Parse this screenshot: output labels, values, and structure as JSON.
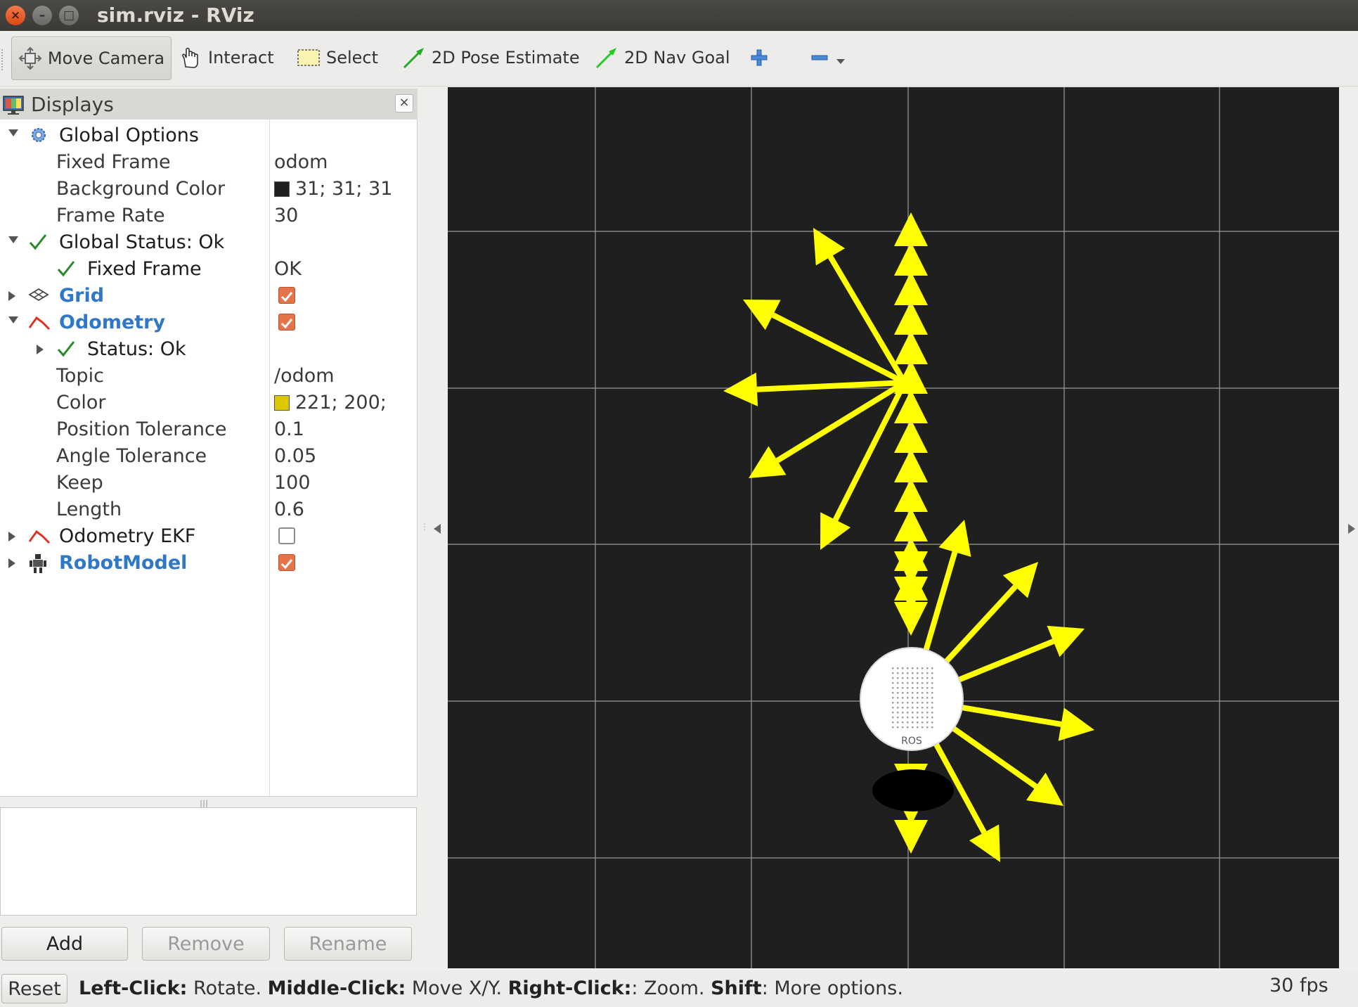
{
  "window": {
    "title": "sim.rviz - RViz",
    "buttons": {
      "close": "×",
      "minimize": "–",
      "maximize": "□"
    }
  },
  "toolbar": {
    "move_camera": "Move Camera",
    "interact": "Interact",
    "select": "Select",
    "pose_estimate": "2D Pose Estimate",
    "nav_goal": "2D Nav Goal"
  },
  "displays": {
    "title": "Displays",
    "close": "×",
    "rows": {
      "global_options": "Global Options",
      "fixed_frame_label": "Fixed Frame",
      "fixed_frame_value": "odom",
      "bg_color_label": "Background Color",
      "bg_color_value": "31; 31; 31",
      "frame_rate_label": "Frame Rate",
      "frame_rate_value": "30",
      "global_status": "Global Status: Ok",
      "status_fixed_frame": "Fixed Frame",
      "status_fixed_frame_value": "OK",
      "grid": "Grid",
      "odometry": "Odometry",
      "odom_status": "Status: Ok",
      "topic_label": "Topic",
      "topic_value": "/odom",
      "color_label": "Color",
      "color_value": "221; 200;",
      "pos_tol_label": "Position Tolerance",
      "pos_tol_value": "0.1",
      "ang_tol_label": "Angle Tolerance",
      "ang_tol_value": "0.05",
      "keep_label": "Keep",
      "keep_value": "100",
      "length_label": "Length",
      "length_value": "0.6",
      "odometry_ekf": "Odometry EKF",
      "robot_model": "RobotModel"
    },
    "checkboxes": {
      "grid": true,
      "odometry": true,
      "odometry_ekf": false,
      "robot_model": true
    },
    "buttons": {
      "add": "Add",
      "remove": "Remove",
      "rename": "Rename"
    }
  },
  "colors": {
    "background": "#1f1f1f",
    "arrow": "#ffff00",
    "odom_color": "#ddc800",
    "checkbox": "#e4734a"
  },
  "viewport": {
    "robot_label": "ROS"
  },
  "status": {
    "reset": "Reset",
    "left_click": "Left-Click:",
    "left_click_text": " Rotate. ",
    "middle_click": "Middle-Click:",
    "middle_click_text": " Move X/Y. ",
    "right_click": "Right-Click:",
    "right_click_text": ": Zoom. ",
    "shift": "Shift",
    "shift_text": ": More options.",
    "fps": "30 fps"
  }
}
